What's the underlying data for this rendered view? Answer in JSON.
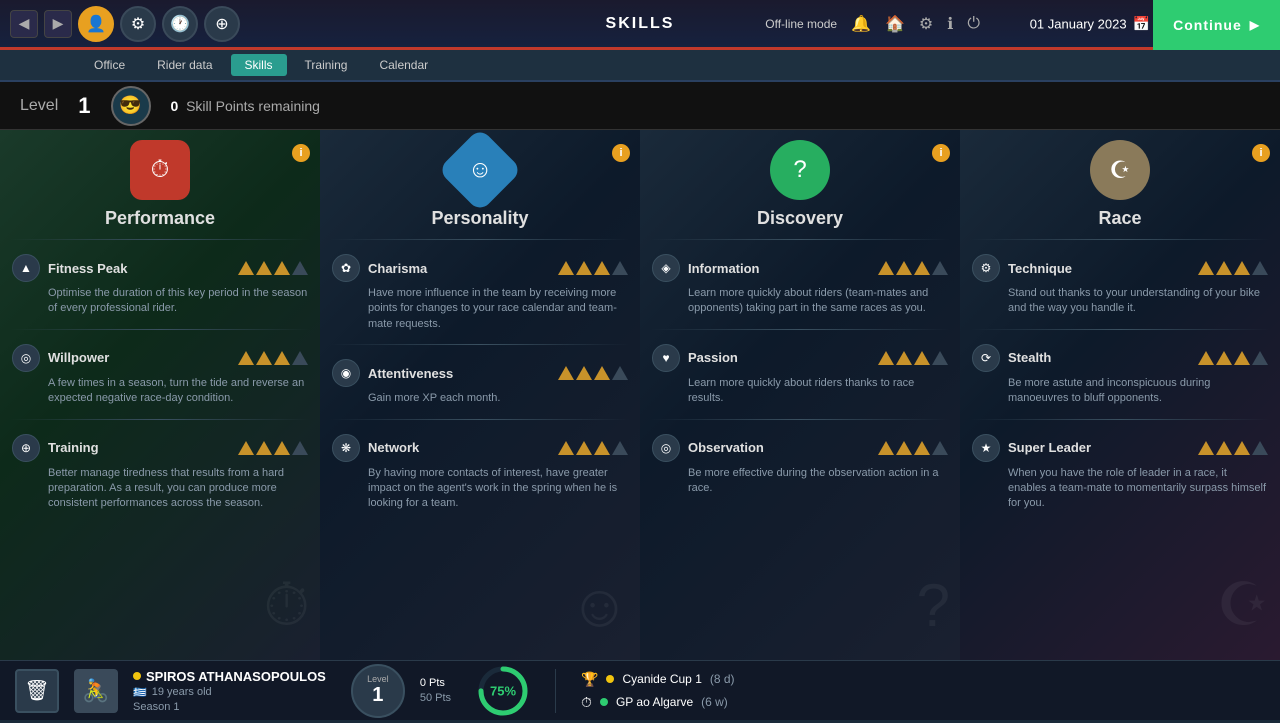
{
  "topbar": {
    "title": "SKILLS",
    "date": "01 January 2023",
    "continue_label": "Continue",
    "offline_mode": "Off-line mode"
  },
  "subnav": {
    "items": [
      "Office",
      "Rider data",
      "Skills",
      "Training",
      "Calendar"
    ],
    "active": "Skills"
  },
  "levelbar": {
    "level_label": "Level",
    "level_value": "1",
    "skill_points_label": "Skill Points remaining",
    "skill_points_value": "0"
  },
  "columns": [
    {
      "id": "performance",
      "title": "Performance",
      "icon": "⏱",
      "color": "red",
      "skills": [
        {
          "name": "Fitness Peak",
          "icon": "▲",
          "stars": 3,
          "max_stars": 4,
          "desc": "Optimise the duration of this key period in the season of every professional rider."
        },
        {
          "name": "Willpower",
          "icon": "◎",
          "stars": 3,
          "max_stars": 4,
          "desc": "A few times in a season, turn the tide and reverse an expected negative race-day condition."
        },
        {
          "name": "Training",
          "icon": "⊕",
          "stars": 3,
          "max_stars": 4,
          "desc": "Better manage tiredness that results from a hard preparation. As a result, you can produce more consistent performances across the season."
        }
      ]
    },
    {
      "id": "personality",
      "title": "Personality",
      "icon": "☺",
      "color": "blue",
      "skills": [
        {
          "name": "Charisma",
          "icon": "✿",
          "stars": 3,
          "max_stars": 4,
          "desc": "Have more influence in the team by receiving more points for changes to your race calendar and team-mate requests."
        },
        {
          "name": "Attentiveness",
          "icon": "◉",
          "stars": 3,
          "max_stars": 4,
          "desc": "Gain more XP each month."
        },
        {
          "name": "Network",
          "icon": "❋",
          "stars": 3,
          "max_stars": 4,
          "desc": "By having more contacts of interest, have greater impact on the agent's work in the spring when he is looking for a team."
        }
      ]
    },
    {
      "id": "discovery",
      "title": "Discovery",
      "icon": "?",
      "color": "green",
      "skills": [
        {
          "name": "Information",
          "icon": "◈",
          "stars": 3,
          "max_stars": 4,
          "desc": "Learn more quickly about riders (team-mates and opponents) taking part in the same races as you."
        },
        {
          "name": "Passion",
          "icon": "♥",
          "stars": 3,
          "max_stars": 4,
          "desc": "Learn more quickly about riders thanks to race results."
        },
        {
          "name": "Observation",
          "icon": "◎",
          "stars": 3,
          "max_stars": 4,
          "desc": "Be more effective during the observation action in a race."
        }
      ]
    },
    {
      "id": "race",
      "title": "Race",
      "icon": "☪",
      "color": "tan",
      "skills": [
        {
          "name": "Technique",
          "icon": "⚙",
          "stars": 3,
          "max_stars": 4,
          "desc": "Stand out thanks to your understanding of your bike and the way you handle it."
        },
        {
          "name": "Stealth",
          "icon": "⟳",
          "stars": 3,
          "max_stars": 4,
          "desc": "Be more astute and inconspicuous during manoeuvres to bluff opponents."
        },
        {
          "name": "Super Leader",
          "icon": "★",
          "stars": 3,
          "max_stars": 4,
          "desc": "When you have the role of leader in a race, it enables a team-mate to momentarily surpass himself for you."
        }
      ]
    }
  ],
  "bottombar": {
    "rider_name": "SPIROS ATHANASOPOULOS",
    "rider_age": "19 years old",
    "rider_season": "Season 1",
    "level_label": "Level",
    "level_value": "1",
    "pts_current": "0 Pts",
    "pts_total": "50 Pts",
    "progress_pct": "75%",
    "races": [
      {
        "icon": "🏆",
        "name": "Cyanide Cup 1",
        "detail": "(8 d)"
      },
      {
        "icon": "⏱",
        "name": "GP ao Algarve",
        "detail": "(6 w)"
      }
    ]
  },
  "icons": {
    "info": "i",
    "star_filled": "▲",
    "star_empty": "△"
  }
}
